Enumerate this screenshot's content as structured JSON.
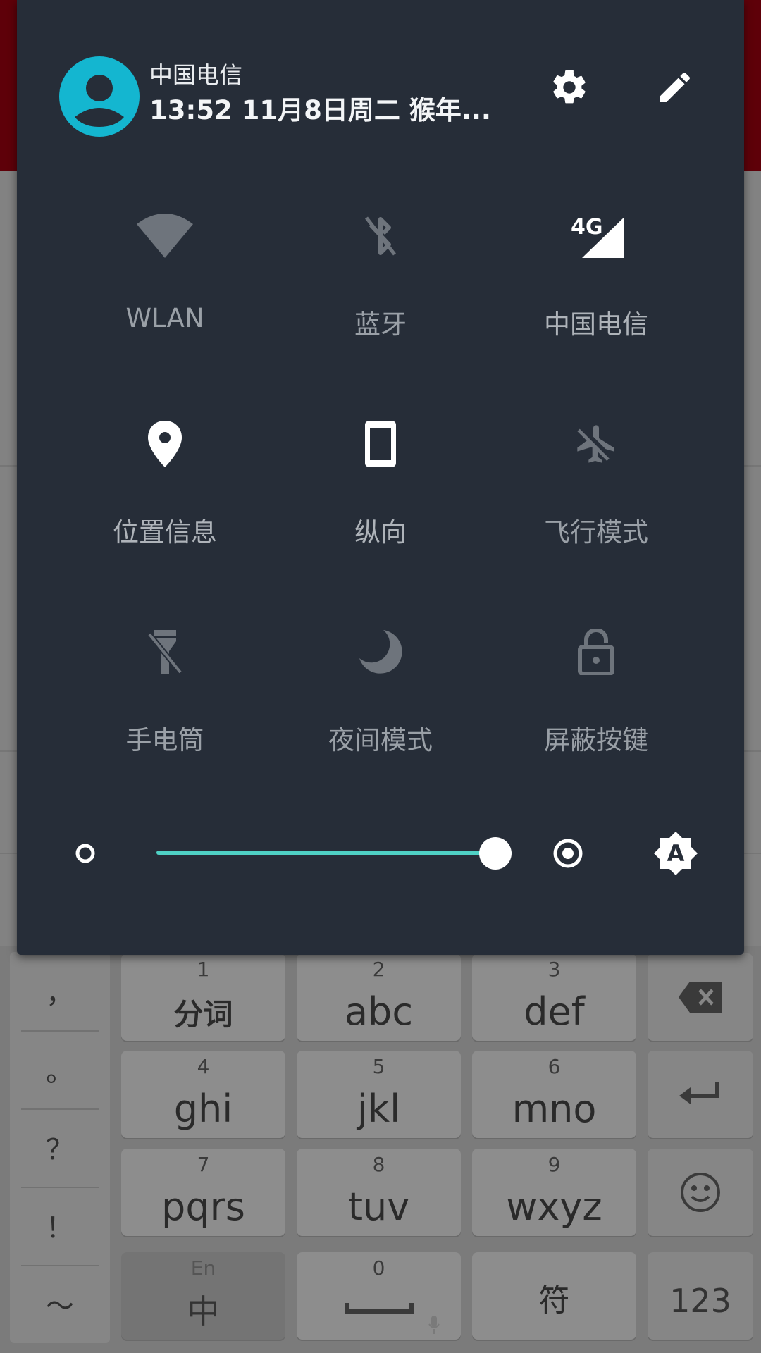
{
  "status": {
    "carrier": "中国电信",
    "datetime": "13:52  11月8日周二 猴年..."
  },
  "header": {
    "avatar_icon": "account-circle-icon",
    "settings_icon": "gear-icon",
    "edit_icon": "pencil-icon"
  },
  "tiles": [
    {
      "label": "WLAN",
      "icon": "wifi-icon",
      "state": "off"
    },
    {
      "label": "蓝牙",
      "icon": "bluetooth-off-icon",
      "state": "off"
    },
    {
      "label": "中国电信",
      "icon": "cellular-4g-icon",
      "state": "on"
    },
    {
      "label": "位置信息",
      "icon": "location-pin-icon",
      "state": "on"
    },
    {
      "label": "纵向",
      "icon": "portrait-phone-icon",
      "state": "on"
    },
    {
      "label": "飞行模式",
      "icon": "airplane-off-icon",
      "state": "off"
    },
    {
      "label": "手电筒",
      "icon": "flashlight-off-icon",
      "state": "off"
    },
    {
      "label": "夜间模式",
      "icon": "moon-icon",
      "state": "off"
    },
    {
      "label": "屏蔽按键",
      "icon": "lock-open-icon",
      "state": "off"
    }
  ],
  "brightness": {
    "level": 1.0,
    "auto_label": "A"
  },
  "keyboard": {
    "symbols": [
      "，",
      "。",
      "？",
      "！",
      "～"
    ],
    "keys": [
      {
        "num": "1",
        "label": "分词"
      },
      {
        "num": "2",
        "label": "abc"
      },
      {
        "num": "3",
        "label": "def"
      },
      {
        "num": "4",
        "label": "ghi"
      },
      {
        "num": "5",
        "label": "jkl"
      },
      {
        "num": "6",
        "label": "mno"
      },
      {
        "num": "7",
        "label": "pqrs"
      },
      {
        "num": "8",
        "label": "tuv"
      },
      {
        "num": "9",
        "label": "wxyz"
      }
    ],
    "lang_key": {
      "num": "En",
      "label": "中"
    },
    "space_key": {
      "num": "0"
    },
    "symbol_key": "符",
    "num_key": "123"
  },
  "colors": {
    "panel_bg": "#262d38",
    "accent": "#4fd1c5",
    "avatar": "#14b6d0"
  }
}
